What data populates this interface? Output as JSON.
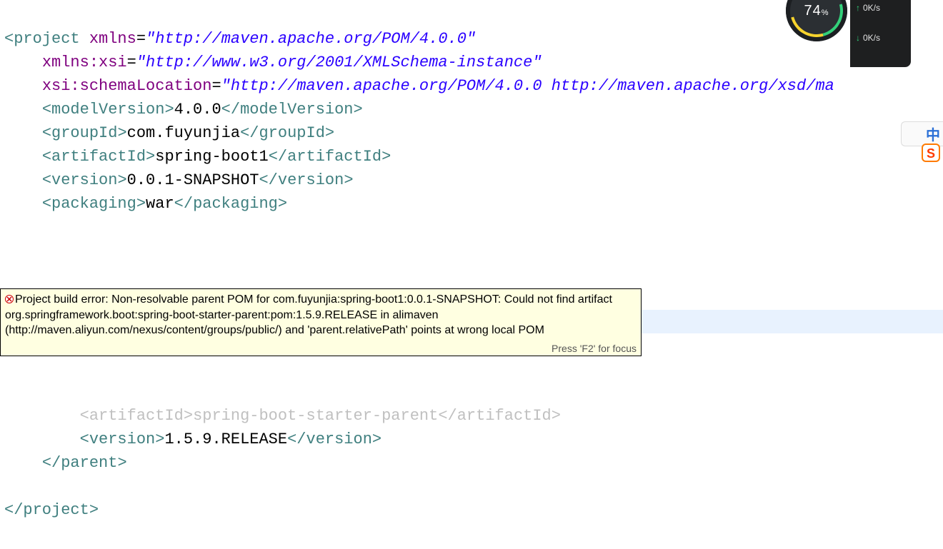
{
  "xml": {
    "project_open": "project",
    "xmlns_attr": "xmlns",
    "xmlns_val": "\"http://maven.apache.org/POM/4.0.0\"",
    "xmlns_xsi_attr": "xmlns:xsi",
    "xmlns_xsi_val": "\"http://www.w3.org/2001/XMLSchema-instance\"",
    "xsi_schema_attr": "xsi:schemaLocation",
    "xsi_schema_val": "\"http://maven.apache.org/POM/4.0.0 http://maven.apache.org/xsd/ma",
    "modelVersion_tag": "modelVersion",
    "modelVersion_val": "4.0.0",
    "groupId_tag": "groupId",
    "groupId_val": "com.fuyunjia",
    "artifactId_tag": "artifactId",
    "artifactId_val": "spring-boot1",
    "version_tag": "version",
    "version_val": "0.0.1-SNAPSHOT",
    "packaging_tag": "packaging",
    "packaging_val": "war",
    "parent_tag": "parent",
    "parent_artifactId_tag": "artifactId",
    "parent_artifactId_val": "spring-boot-starter-parent",
    "parent_version_tag": "version",
    "parent_version_val": "1.5.9.RELEASE",
    "project_close": "project"
  },
  "tooltip": {
    "message": "Project build error: Non-resolvable parent POM for com.fuyunjia:spring-boot1:0.0.1-SNAPSHOT: Could not find artifact org.springframework.boot:spring-boot-starter-parent:pom:1.5.9.RELEASE in alimaven (http://maven.aliyun.com/nexus/content/groups/public/) and 'parent.relativePath' points at wrong local POM",
    "hint": "Press 'F2' for focus"
  },
  "netmon": {
    "percent": "74",
    "percent_suffix": "%",
    "up": "0K/s",
    "down": "0K/s"
  },
  "ime": {
    "letter": "S",
    "lang": "中"
  }
}
